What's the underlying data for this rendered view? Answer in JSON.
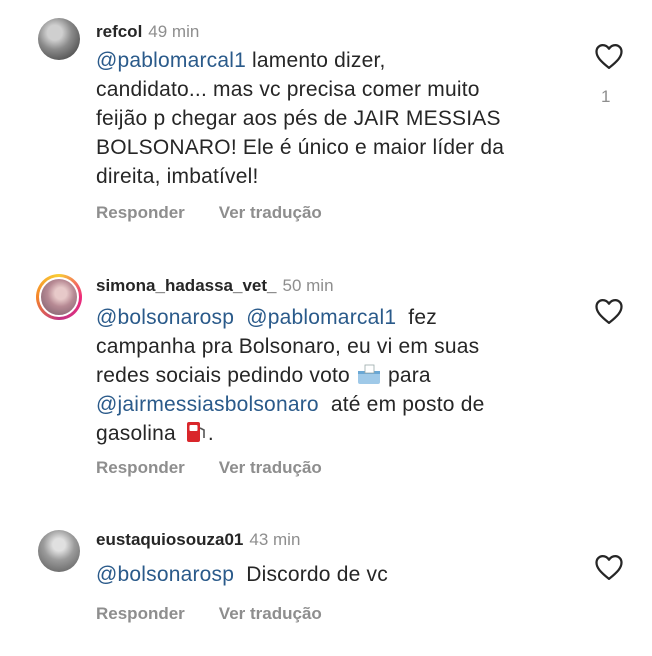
{
  "comments": [
    {
      "username": "refcol",
      "time": "49 min",
      "mention1": "@pablomarcal1",
      "text1": " lamento dizer,",
      "line2": "candidato... mas vc precisa comer muito",
      "line3": "feijão p chegar aos pés de JAIR MESSIAS",
      "line4": "BOLSONARO! Ele é único e maior líder da",
      "line5": "direita, imbatível!",
      "reply": "Responder",
      "translate": "Ver tradução",
      "like_count": "1",
      "avatar_icon": "user-avatar"
    },
    {
      "username": "simona_hadassa_vet_",
      "time": "50 min",
      "mention1": "@bolsonarosp",
      "mention2": "@pablomarcal1",
      "text1": "fez",
      "line2": "campanha  pra Bolsonaro, eu vi em suas",
      "line3a": "redes sociais pedindo voto",
      "line3b": "para",
      "mention3": "@jairmessiasbolsonaro",
      "line4b": "até em posto de",
      "line5a": "gasolina",
      "line5b": ".",
      "reply": "Responder",
      "translate": "Ver tradução",
      "ballot_icon": "ballot-box-emoji",
      "fuel_icon": "fuel-pump-emoji"
    },
    {
      "username": "eustaquiosouza01",
      "time": "43 min",
      "mention1": "@bolsonarosp",
      "text1": "Discordo de vc",
      "reply": "Responder",
      "translate": "Ver tradução"
    }
  ],
  "colors": {
    "mention": "#2a5a8a",
    "muted": "#8e8e8e",
    "text": "#262626"
  }
}
